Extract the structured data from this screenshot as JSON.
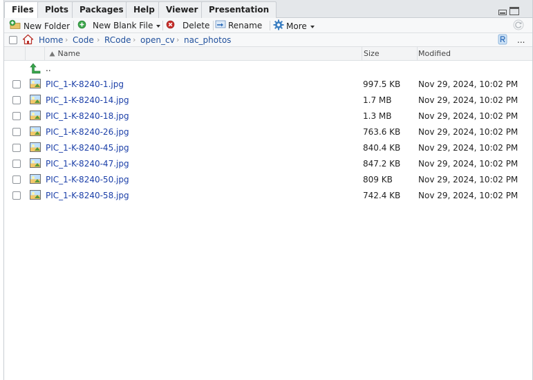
{
  "tabs": [
    {
      "label": "Files",
      "active": true
    },
    {
      "label": "Plots"
    },
    {
      "label": "Packages"
    },
    {
      "label": "Help"
    },
    {
      "label": "Viewer"
    },
    {
      "label": "Presentation"
    }
  ],
  "toolbar": {
    "new_folder": "New Folder",
    "new_blank_file": "New Blank File",
    "delete": "Delete",
    "rename": "Rename",
    "more": "More"
  },
  "breadcrumb": [
    "Home",
    "Code",
    "RCode",
    "open_cv",
    "nac_photos"
  ],
  "breadcrumb_more": "...",
  "columns": {
    "name": "Name",
    "size": "Size",
    "modified": "Modified"
  },
  "parent_dir": "..",
  "files": [
    {
      "name": "PIC_1-K-8240-1.jpg",
      "size": "997.5 KB",
      "modified": "Nov 29, 2024, 10:02 PM"
    },
    {
      "name": "PIC_1-K-8240-14.jpg",
      "size": "1.7 MB",
      "modified": "Nov 29, 2024, 10:02 PM"
    },
    {
      "name": "PIC_1-K-8240-18.jpg",
      "size": "1.3 MB",
      "modified": "Nov 29, 2024, 10:02 PM"
    },
    {
      "name": "PIC_1-K-8240-26.jpg",
      "size": "763.6 KB",
      "modified": "Nov 29, 2024, 10:02 PM"
    },
    {
      "name": "PIC_1-K-8240-45.jpg",
      "size": "840.4 KB",
      "modified": "Nov 29, 2024, 10:02 PM"
    },
    {
      "name": "PIC_1-K-8240-47.jpg",
      "size": "847.2 KB",
      "modified": "Nov 29, 2024, 10:02 PM"
    },
    {
      "name": "PIC_1-K-8240-50.jpg",
      "size": "809 KB",
      "modified": "Nov 29, 2024, 10:02 PM"
    },
    {
      "name": "PIC_1-K-8240-58.jpg",
      "size": "742.4 KB",
      "modified": "Nov 29, 2024, 10:02 PM"
    }
  ],
  "colors": {
    "link": "#1b3fa8",
    "crumb": "#1f4f9c",
    "tab_bg": "#e4e7ea"
  }
}
